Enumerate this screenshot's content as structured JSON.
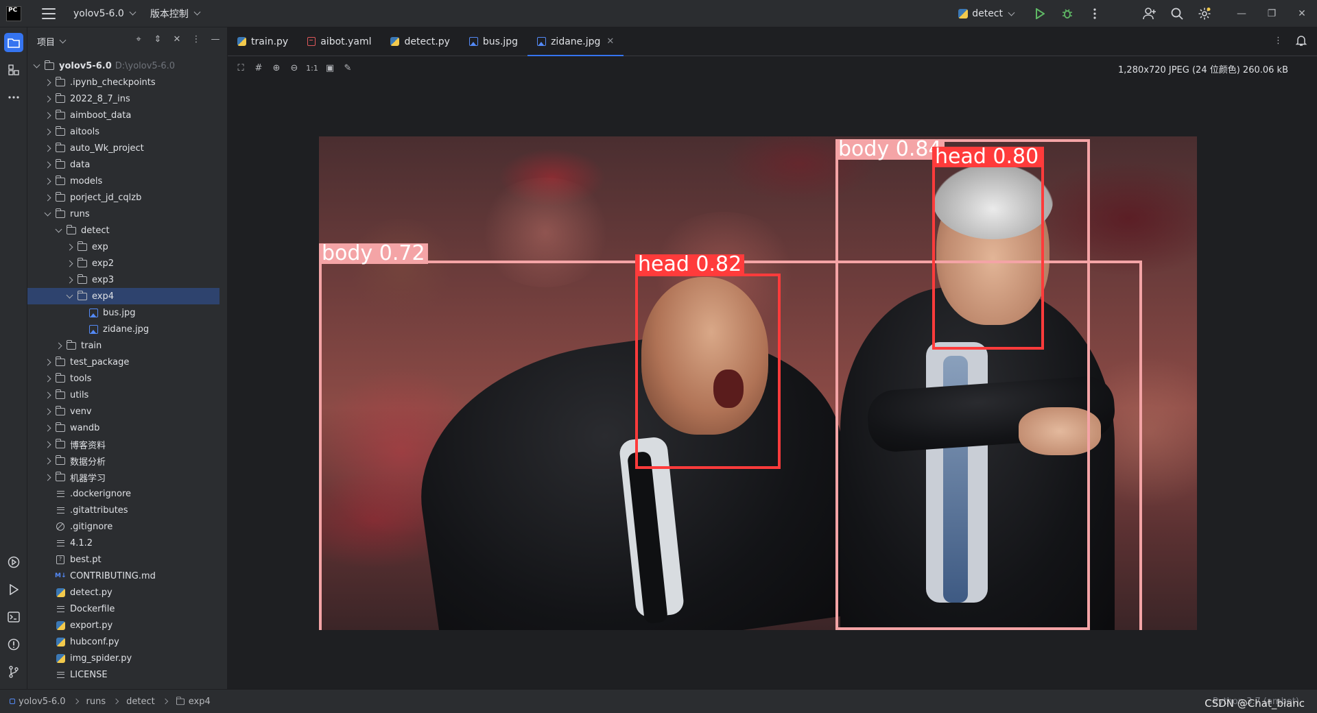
{
  "titlebar": {
    "logo_text": "PC",
    "project_name": "yolov5-6.0",
    "vcs_label": "版本控制",
    "run_config": "detect"
  },
  "toolstrip": {
    "items": [
      "project-icon",
      "structure-icon",
      "more-icon",
      "services-icon",
      "run-icon",
      "terminal-icon",
      "problems-icon",
      "git-icon"
    ]
  },
  "project_panel": {
    "header_label": "项目",
    "tree": [
      {
        "label": "yolov5-6.0",
        "path": "D:\\yolov5-6.0",
        "level": 0,
        "arrow": "d",
        "icon": "folder",
        "bold": true
      },
      {
        "label": ".ipynb_checkpoints",
        "level": 1,
        "arrow": "r",
        "icon": "folder"
      },
      {
        "label": "2022_8_7_ins",
        "level": 1,
        "arrow": "r",
        "icon": "folder"
      },
      {
        "label": "aimboot_data",
        "level": 1,
        "arrow": "r",
        "icon": "folder"
      },
      {
        "label": "aitools",
        "level": 1,
        "arrow": "r",
        "icon": "folder"
      },
      {
        "label": "auto_Wk_project",
        "level": 1,
        "arrow": "r",
        "icon": "folder"
      },
      {
        "label": "data",
        "level": 1,
        "arrow": "r",
        "icon": "folder"
      },
      {
        "label": "models",
        "level": 1,
        "arrow": "r",
        "icon": "folder"
      },
      {
        "label": "porject_jd_cqlzb",
        "level": 1,
        "arrow": "r",
        "icon": "folder"
      },
      {
        "label": "runs",
        "level": 1,
        "arrow": "d",
        "icon": "folder"
      },
      {
        "label": "detect",
        "level": 2,
        "arrow": "d",
        "icon": "folder"
      },
      {
        "label": "exp",
        "level": 3,
        "arrow": "r",
        "icon": "folder"
      },
      {
        "label": "exp2",
        "level": 3,
        "arrow": "r",
        "icon": "folder"
      },
      {
        "label": "exp3",
        "level": 3,
        "arrow": "r",
        "icon": "folder"
      },
      {
        "label": "exp4",
        "level": 3,
        "arrow": "d",
        "icon": "folder",
        "selected": true
      },
      {
        "label": "bus.jpg",
        "level": 4,
        "arrow": "n",
        "icon": "image"
      },
      {
        "label": "zidane.jpg",
        "level": 4,
        "arrow": "n",
        "icon": "image"
      },
      {
        "label": "train",
        "level": 2,
        "arrow": "r",
        "icon": "folder"
      },
      {
        "label": "test_package",
        "level": 1,
        "arrow": "r",
        "icon": "folder"
      },
      {
        "label": "tools",
        "level": 1,
        "arrow": "r",
        "icon": "folder"
      },
      {
        "label": "utils",
        "level": 1,
        "arrow": "r",
        "icon": "folder"
      },
      {
        "label": "venv",
        "level": 1,
        "arrow": "r",
        "icon": "folder"
      },
      {
        "label": "wandb",
        "level": 1,
        "arrow": "r",
        "icon": "folder"
      },
      {
        "label": "博客资料",
        "level": 1,
        "arrow": "r",
        "icon": "folder"
      },
      {
        "label": "数据分析",
        "level": 1,
        "arrow": "r",
        "icon": "folder"
      },
      {
        "label": "机器学习",
        "level": 1,
        "arrow": "r",
        "icon": "folder"
      },
      {
        "label": ".dockerignore",
        "level": 1,
        "arrow": "n",
        "icon": "text"
      },
      {
        "label": ".gitattributes",
        "level": 1,
        "arrow": "n",
        "icon": "text"
      },
      {
        "label": ".gitignore",
        "level": 1,
        "arrow": "n",
        "icon": "ignore"
      },
      {
        "label": "4.1.2",
        "level": 1,
        "arrow": "n",
        "icon": "text"
      },
      {
        "label": "best.pt",
        "level": 1,
        "arrow": "n",
        "icon": "unknown"
      },
      {
        "label": "CONTRIBUTING.md",
        "level": 1,
        "arrow": "n",
        "icon": "markdown"
      },
      {
        "label": "detect.py",
        "level": 1,
        "arrow": "n",
        "icon": "python"
      },
      {
        "label": "Dockerfile",
        "level": 1,
        "arrow": "n",
        "icon": "text"
      },
      {
        "label": "export.py",
        "level": 1,
        "arrow": "n",
        "icon": "python"
      },
      {
        "label": "hubconf.py",
        "level": 1,
        "arrow": "n",
        "icon": "python"
      },
      {
        "label": "img_spider.py",
        "level": 1,
        "arrow": "n",
        "icon": "python"
      },
      {
        "label": "LICENSE",
        "level": 1,
        "arrow": "n",
        "icon": "text"
      }
    ]
  },
  "tabs": [
    {
      "label": "train.py",
      "icon": "python"
    },
    {
      "label": "aibot.yaml",
      "icon": "yaml"
    },
    {
      "label": "detect.py",
      "icon": "python"
    },
    {
      "label": "bus.jpg",
      "icon": "image"
    },
    {
      "label": "zidane.jpg",
      "icon": "image",
      "active": true
    }
  ],
  "image_toolbar": {
    "zoom_actual_label": "1:1",
    "info": "1,280x720 JPEG (24 位颜色) 260.06 kB"
  },
  "detections": [
    {
      "label": "body 0.72",
      "color": "#f4a4a6"
    },
    {
      "label": "head 0.82",
      "color": "#ff3b3b"
    },
    {
      "label": "body 0.84",
      "color": "#f4a4a6"
    },
    {
      "label": "head 0.80",
      "color": "#ff3b3b"
    }
  ],
  "statusbar": {
    "breadcrumb": [
      "yolov5-6.0",
      "runs",
      "detect",
      "exp4"
    ],
    "interpreter": "Python 3.7 (ambot)",
    "watermark": "CSDN @Chat_bianc"
  }
}
